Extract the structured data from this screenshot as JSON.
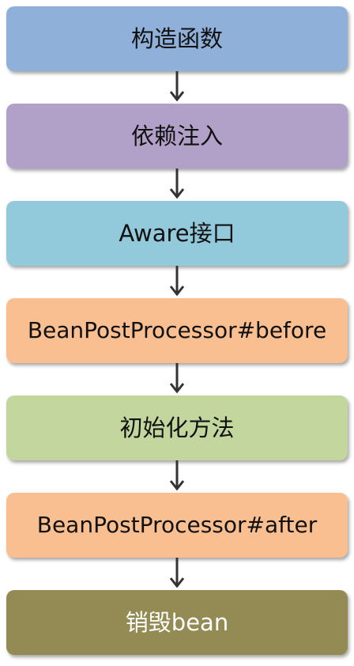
{
  "diagram": {
    "stages": [
      {
        "id": "constructor",
        "label": "构造函数",
        "color": "#8fb1d9"
      },
      {
        "id": "dependency-injection",
        "label": "依赖注入",
        "color": "#b1a0c8"
      },
      {
        "id": "aware-interface",
        "label": "Aware接口",
        "color": "#93cadb"
      },
      {
        "id": "bpp-before",
        "label": "BeanPostProcessor#before",
        "color": "#f9bf91"
      },
      {
        "id": "init-method",
        "label": "初始化方法",
        "color": "#c3d69e"
      },
      {
        "id": "bpp-after",
        "label": "BeanPostProcessor#after",
        "color": "#f9bf91"
      },
      {
        "id": "destroy-bean",
        "label": "销毁bean",
        "color": "#948a54",
        "text_color": "#ffffff"
      }
    ],
    "arrow_color": "#333333"
  }
}
